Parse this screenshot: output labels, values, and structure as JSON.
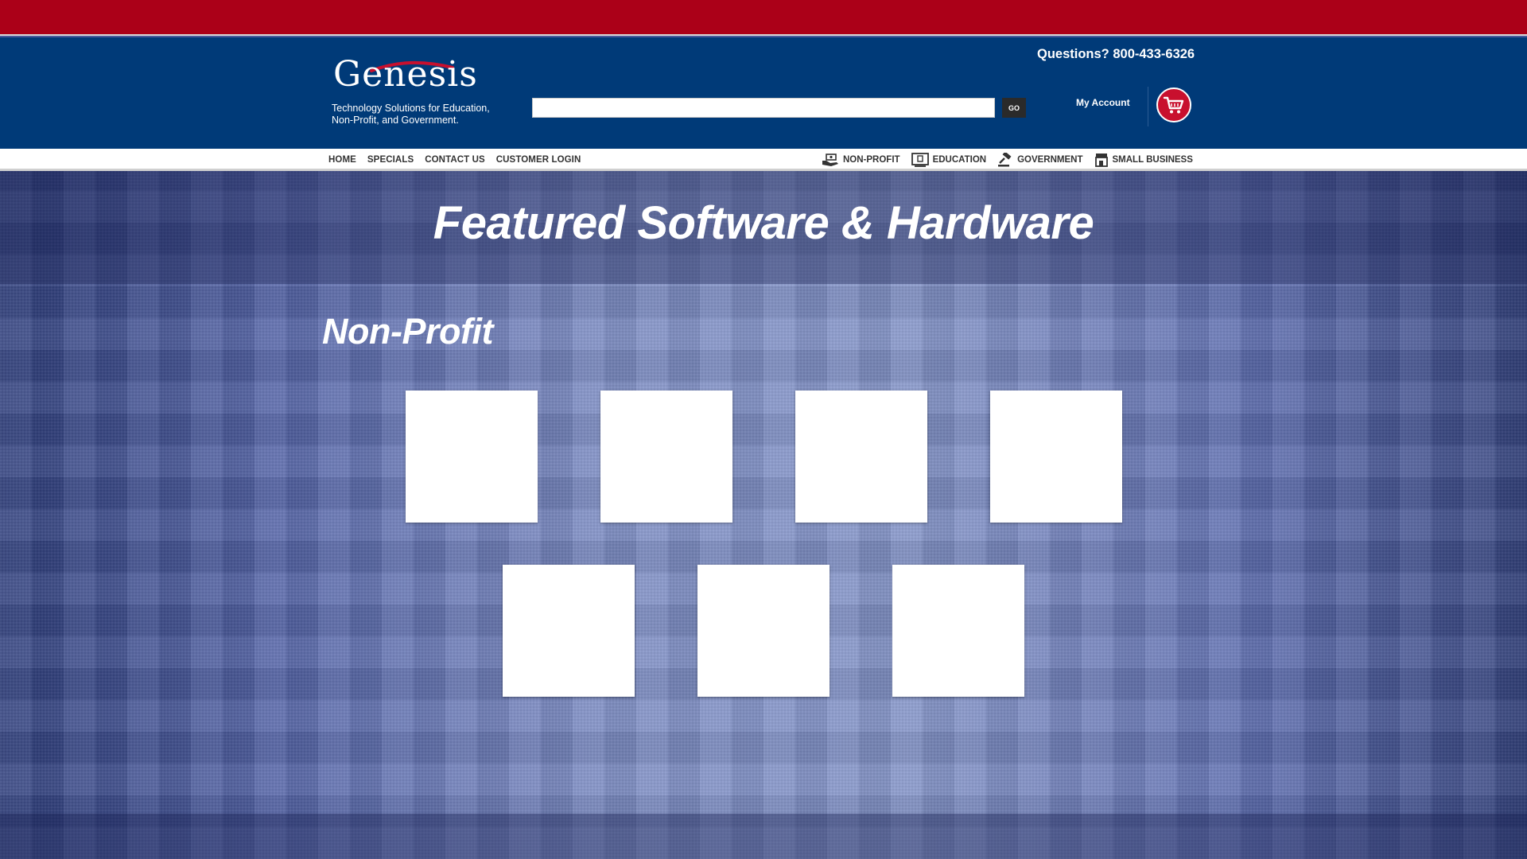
{
  "brand": {
    "logo_text": "Genesis",
    "tagline_line1": "Technology Solutions for Education,",
    "tagline_line2": "Non-Profit, and Government.",
    "accent_red": "#ab0018",
    "header_blue": "#003a78"
  },
  "header": {
    "phone": "Questions? 800-433-6326",
    "search_value": "",
    "search_placeholder": "",
    "go_label": "GO",
    "account_label": "My Account",
    "cart_icon": "shopping-cart-icon"
  },
  "nav": {
    "left": [
      {
        "label": "HOME"
      },
      {
        "label": "SPECIALS"
      },
      {
        "label": "CONTACT US"
      },
      {
        "label": "CUSTOMER LOGIN"
      }
    ],
    "right": [
      {
        "label": "NON-PROFIT",
        "icon": "hand-money-icon"
      },
      {
        "label": "EDUCATION",
        "icon": "chalkboard-icon"
      },
      {
        "label": "GOVERNMENT",
        "icon": "gavel-icon"
      },
      {
        "label": "SMALL BUSINESS",
        "icon": "storefront-icon"
      }
    ]
  },
  "main": {
    "hero_title": "Featured Software & Hardware",
    "section_title": "Non-Profit",
    "product_tile_count": 7
  }
}
